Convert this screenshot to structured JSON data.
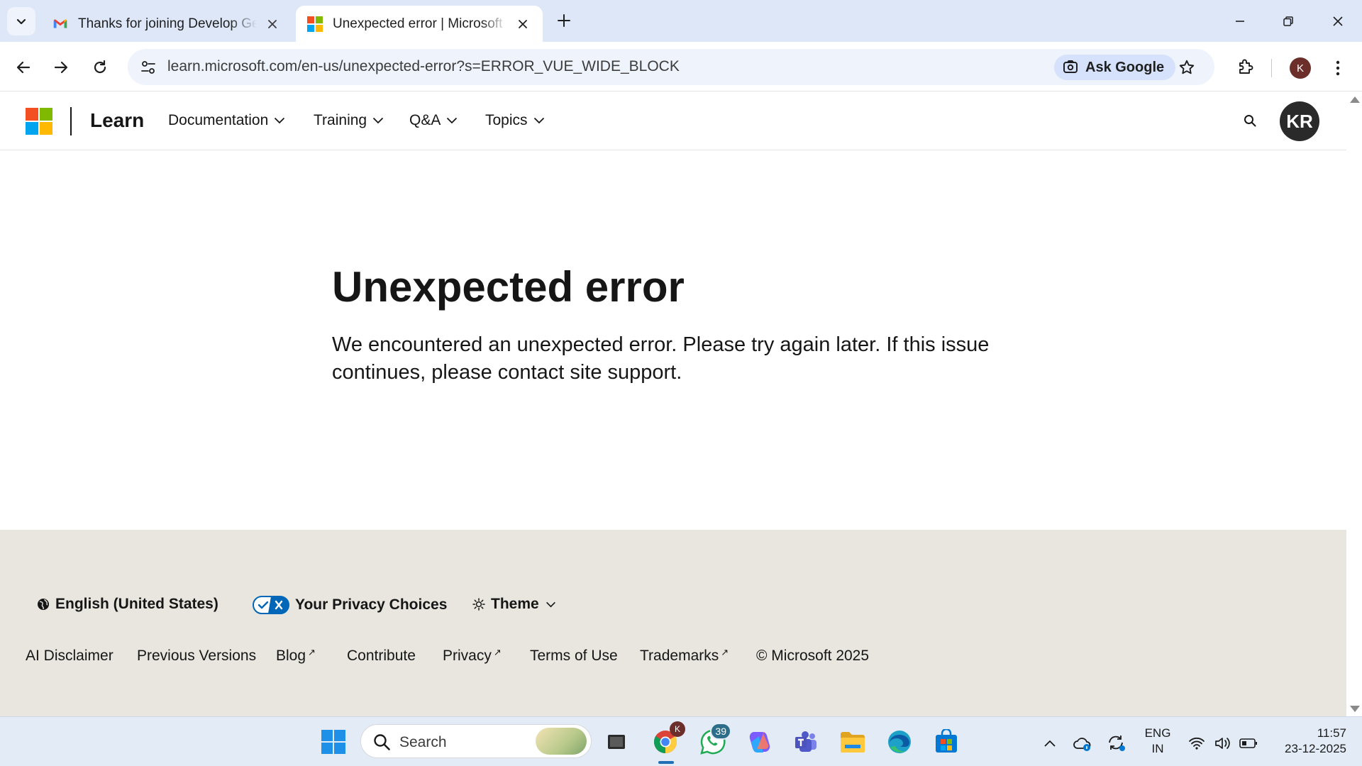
{
  "browser": {
    "tabs": [
      {
        "title": "Thanks for joining Develop Gen",
        "favicon": "gmail-icon",
        "active": false
      },
      {
        "title": "Unexpected error | Microsoft Le",
        "favicon": "microsoft-icon",
        "active": true
      }
    ],
    "url": "learn.microsoft.com/en-us/unexpected-error?s=ERROR_VUE_WIDE_BLOCK",
    "ask_google": "Ask Google",
    "profile_initial": "K"
  },
  "site": {
    "brand": "Learn",
    "nav": [
      {
        "label": "Documentation"
      },
      {
        "label": "Training"
      },
      {
        "label": "Q&A"
      },
      {
        "label": "Topics"
      }
    ],
    "avatar_initials": "KR"
  },
  "error": {
    "title": "Unexpected error",
    "message": "We encountered an unexpected error. Please try again later. If this issue continues, please contact site support."
  },
  "footer": {
    "language": "English (United States)",
    "privacy_choices": "Your Privacy Choices",
    "theme": "Theme",
    "links": [
      {
        "label": "AI Disclaimer",
        "external": false
      },
      {
        "label": "Previous Versions",
        "external": false
      },
      {
        "label": "Blog",
        "external": true
      },
      {
        "label": "Contribute",
        "external": false
      },
      {
        "label": "Privacy",
        "external": true
      },
      {
        "label": "Terms of Use",
        "external": false
      },
      {
        "label": "Trademarks",
        "external": true
      }
    ],
    "copyright": "© Microsoft 2025",
    "external_marker": "↗"
  },
  "taskbar": {
    "search_label": "Search",
    "chrome_badge": "K",
    "whatsapp_badge": "39",
    "lang_line1": "ENG",
    "lang_line2": "IN",
    "time": "11:57",
    "date": "23-12-2025"
  },
  "colors": {
    "ms_red": "#f25022",
    "ms_green": "#7fba00",
    "ms_blue": "#00a4ef",
    "ms_yellow": "#ffb900",
    "footer_bg": "#e8e6df",
    "tabbar_bg": "#dde7f8"
  }
}
